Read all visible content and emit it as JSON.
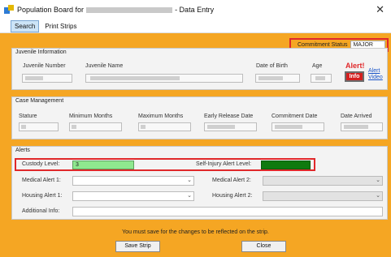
{
  "window": {
    "title_prefix": "Population Board for",
    "title_suffix": "- Data Entry",
    "close_glyph": "✕"
  },
  "menu": {
    "search": "Search",
    "print_strips": "Print Strips"
  },
  "commitment_status": {
    "label": "Commitment Status",
    "value": "MAJOR"
  },
  "juvenile": {
    "section_title": "Juvenile Information",
    "number_label": "Juvenile Number",
    "name_label": "Juvenile Name",
    "dob_label": "Date of Birth",
    "age_label": "Age",
    "alert_label": "Alert!",
    "info_button": "Info",
    "alert_link": "Alert",
    "video_link": "Video"
  },
  "case_management": {
    "section_title": "Case Management",
    "stature_label": "Stature",
    "min_months_label": "Minimum Months",
    "max_months_label": "Maximum Months",
    "early_release_label": "Early Release Date",
    "commitment_date_label": "Commitment Date",
    "date_arrived_label": "Date Arrived"
  },
  "alerts": {
    "section_title": "Alerts",
    "custody_level_label": "Custody Level:",
    "custody_level_value": "3",
    "self_injury_label": "Self-Injury Alert Level:",
    "self_injury_value": "",
    "medical_alert_1_label": "Medical Alert 1:",
    "medical_alert_2_label": "Medical Alert 2:",
    "housing_alert_1_label": "Housing Alert 1:",
    "housing_alert_2_label": "Housing Alert 2:",
    "additional_info_label": "Additional Info:"
  },
  "footer": {
    "message": "You must save for the changes to be reflected on the strip.",
    "save_button": "Save Strip",
    "close_button": "Close"
  },
  "colors": {
    "background": "#f5a623",
    "highlight_border": "#e0282a",
    "custody_green": "#8fe88f",
    "self_injury_green": "#0f7a0f"
  }
}
